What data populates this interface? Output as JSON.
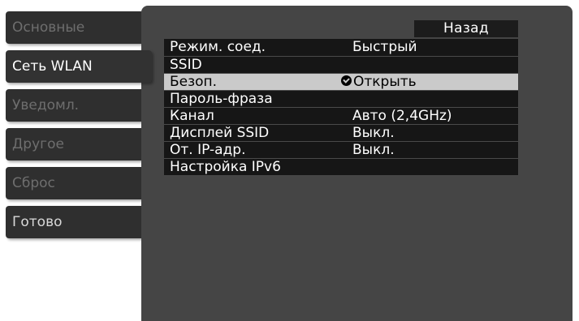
{
  "sidebar": {
    "tabs": [
      {
        "label": "Основные"
      },
      {
        "label": "Сеть WLAN"
      },
      {
        "label": "Уведомл."
      },
      {
        "label": "Другое"
      },
      {
        "label": "Сброс"
      },
      {
        "label": "Готово"
      }
    ]
  },
  "main": {
    "back_label": "Назад",
    "rows": [
      {
        "label": "Режим. соед.",
        "value": "Быстрый"
      },
      {
        "label": "SSID",
        "value": ""
      },
      {
        "label": "Безоп.",
        "value": "Открыть",
        "icon": "checkmark-circle-icon"
      },
      {
        "label": "Пароль-фраза",
        "value": ""
      },
      {
        "label": "Канал",
        "value": "Авто (2,4GHz)"
      },
      {
        "label": "Дисплей SSID",
        "value": "Выкл."
      },
      {
        "label": "От. IP-адр.",
        "value": "Выкл."
      },
      {
        "label": "Настройка IPv6",
        "value": ""
      }
    ]
  },
  "colors": {
    "panel_bg": "#454545",
    "tab_bg": "#2f2f2f",
    "row_bg": "#161616",
    "selected_row_bg": "#cacaca",
    "inactive_tab_text": "#6e6e6e"
  }
}
